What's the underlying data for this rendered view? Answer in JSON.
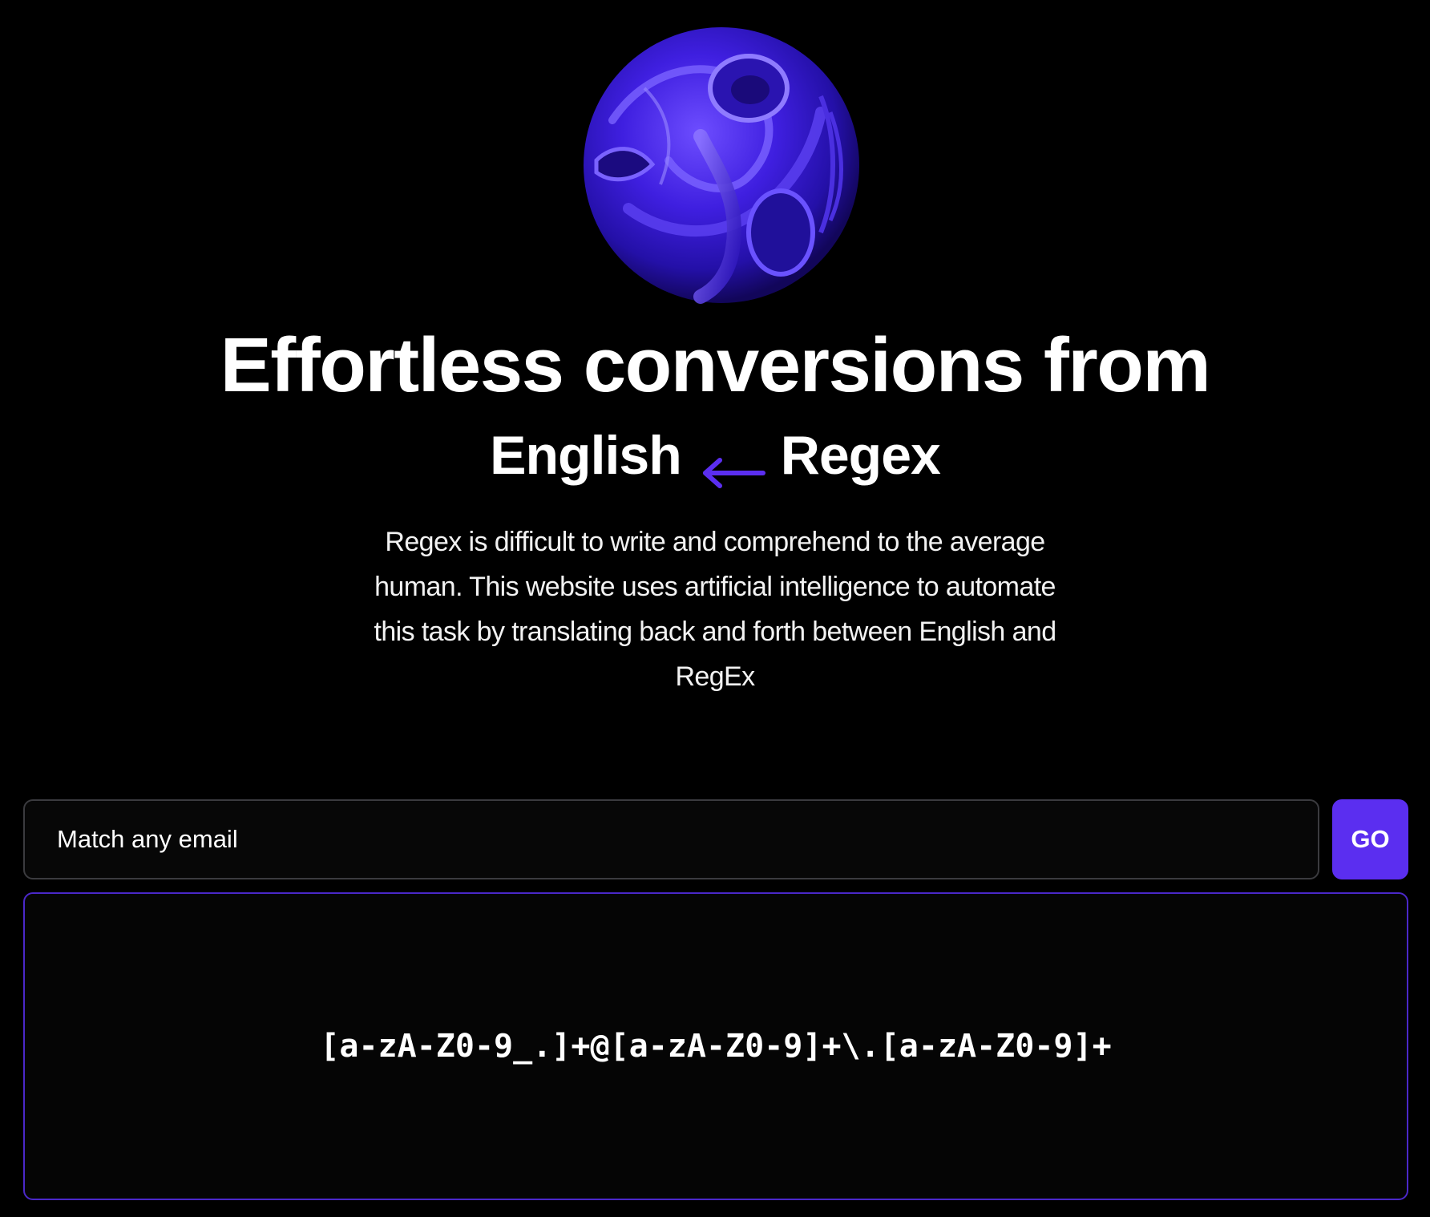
{
  "hero": {
    "title": "Effortless conversions from",
    "from_language": "English",
    "to_language": "Regex",
    "description": "Regex is difficult to write and comprehend to the average human. This website uses artificial intelligence to automate this task by translating back and forth between English and RegEx"
  },
  "converter": {
    "input_value": "Match any email",
    "go_label": "GO",
    "output": "[a-zA-Z0-9_.]+@[a-zA-Z0-9]+\\.[a-zA-Z0-9]+"
  },
  "icons": {
    "arrow": "arrow-left-icon",
    "orb": "abstract-orb-image"
  },
  "colors": {
    "background": "#000000",
    "accent": "#5b2ef0",
    "orb_primary": "#3b1fd6",
    "output_border": "#4b28c9",
    "input_border": "#3b3b3f"
  }
}
